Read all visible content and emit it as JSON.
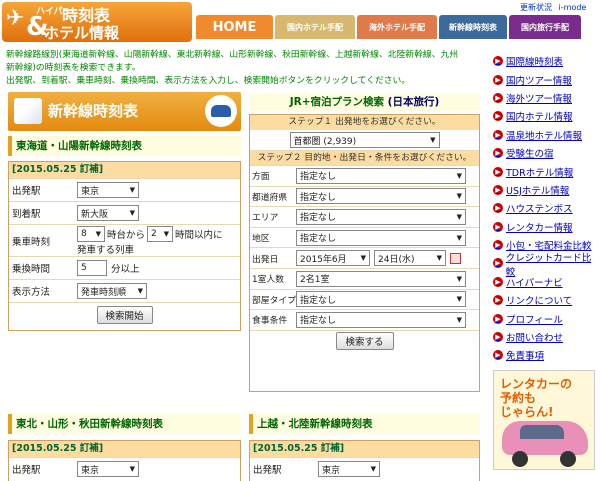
{
  "header": {
    "logo_small": "ハイパー",
    "logo_line1": "時刻表",
    "logo_line2": "ホテル情報",
    "logo_amp": "&",
    "top_links": [
      "更新状況",
      "i-mode"
    ]
  },
  "nav": {
    "items": [
      "HOME",
      "国内ホテル手配",
      "海外ホテル手配",
      "新幹線時刻表",
      "国内旅行手配"
    ]
  },
  "intro": {
    "line1": "新幹線路線別(東海道新幹線、山陽新幹線、東北新幹線、山形新幹線、秋田新幹線、上越新幹線、北陸新幹線、九州",
    "line2": "新幹線)の時刻表を検索できます。",
    "line3": "出発駅、到着駅、乗車時刻、乗換時間、表示方法を入力し、検索開始ボタンをクリックしてください。"
  },
  "shinkansen": {
    "banner_title": "新幹線時刻表",
    "tokaido_title": "東海道・山陽新幹線時刻表",
    "date_header": "[2015.05.25 訂補]",
    "dep_label": "出発駅",
    "dep_value": "東京",
    "arr_label": "到着駅",
    "arr_value": "新大阪",
    "time_label": "乗車時刻",
    "hour_value": "8",
    "hour_suffix": "時台から",
    "range_value": "2",
    "range_suffix": "時間以内に",
    "time_line2": "発車する列車",
    "transfer_label": "乗換時間",
    "transfer_value": "5",
    "transfer_suffix": "分以上",
    "display_label": "表示方法",
    "display_value": "発車時刻順",
    "search_button": "検索開始",
    "tohoku_title": "東北・山形・秋田新幹線時刻表",
    "tohoku_date": "[2015.05.25 訂補]",
    "tohoku_dep_label": "出発駅",
    "tohoku_dep_value": "東京",
    "joetsu_title": "上越・北陸新幹線時刻表",
    "joetsu_date": "[2015.05.25 訂補]",
    "joetsu_dep_label": "出発駅",
    "joetsu_dep_value": "東京"
  },
  "jr": {
    "title_main": "JR+宿泊プラン検索",
    "title_provider": "(日本旅行)",
    "step1": "ステップ１ 出発地をお選びください。",
    "origin_value": "首都圏 (2,939)",
    "step2": "ステップ２ 目的地・出発日・条件をお選びください。",
    "rows": [
      {
        "label": "方面",
        "value": "指定なし"
      },
      {
        "label": "都道府県",
        "value": "指定なし"
      },
      {
        "label": "エリア",
        "value": "指定なし"
      },
      {
        "label": "地区",
        "value": "指定なし"
      }
    ],
    "date_label": "出発日",
    "month_value": "2015年6月",
    "day_value": "24日(水)",
    "people_label": "1室人数",
    "people_value": "2名1室",
    "room_label": "部屋タイプ",
    "room_value": "指定なし",
    "meal_label": "食事条件",
    "meal_value": "指定なし",
    "search_button": "検索する"
  },
  "sidebar": {
    "items": [
      "国際線時刻表",
      "国内ツアー情報",
      "海外ツアー情報",
      "国内ホテル情報",
      "温泉地ホテル情報",
      "受験生の宿",
      "TDRホテル情報",
      "USJホテル情報",
      "ハウステンボス",
      "レンタカー情報",
      "小包・宅配料金比較",
      "クレジットカード比較",
      "ハイパーナビ",
      "リンクについて",
      "プロフィール",
      "お問い合わせ",
      "免責事項"
    ]
  },
  "ad": {
    "line1": "レンタカーの",
    "line2": "予約も",
    "line3": "じゃらん!"
  },
  "colors": {
    "accent_orange": "#e48a10",
    "section_green": "#006600",
    "link_blue": "#0000cc"
  }
}
